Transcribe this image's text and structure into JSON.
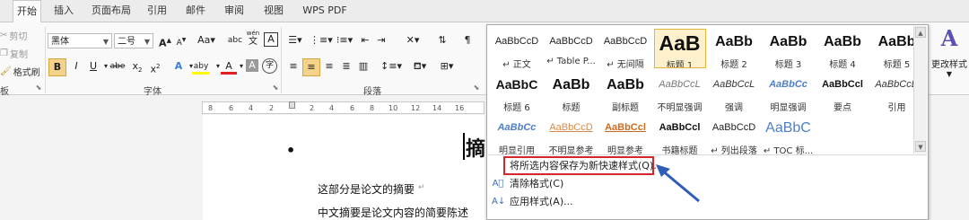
{
  "tabs": [
    "开始",
    "插入",
    "页面布局",
    "引用",
    "邮件",
    "审阅",
    "视图",
    "WPS PDF"
  ],
  "clipboard": {
    "cut": "剪切",
    "copy": "复制",
    "format_painter": "格式刷",
    "group_label": "板"
  },
  "font": {
    "name": "黑体",
    "size": "二号",
    "grow": "A",
    "shrink": "A",
    "case_label": "Aa",
    "clear_label": "abc",
    "pinyin_top": "wén",
    "pinyin_bottom": "文",
    "border_char": "A",
    "bold": "B",
    "italic": "I",
    "underline": "U",
    "strike": "abe",
    "subscript": "x",
    "superscript": "x",
    "effects": "A",
    "highlight": "aby",
    "color": "A",
    "shading_char": "A",
    "circle_char": "字",
    "group_label": "字体"
  },
  "paragraph": {
    "group_label": "段落"
  },
  "ruler": {
    "ticks": [
      "8",
      "6",
      "4",
      "2",
      "2",
      "4",
      "6",
      "8",
      "10",
      "12",
      "14",
      "16"
    ]
  },
  "document": {
    "title_char": "摘",
    "bullet": "•",
    "line1": "这部分是论文的摘要",
    "line2": "中文摘要是论文内容的简要陈述"
  },
  "styles": {
    "rows": [
      [
        {
          "preview": "AaBbCcD",
          "label": "↵ 正文"
        },
        {
          "preview": "AaBbCcD",
          "label": "↵ Table P..."
        },
        {
          "preview": "AaBbCcD",
          "label": "↵ 无间隔"
        },
        {
          "preview": "AaB",
          "label": "标题 1"
        },
        {
          "preview": "AaBb",
          "label": "标题 2"
        },
        {
          "preview": "AaBb",
          "label": "标题 3"
        },
        {
          "preview": "AaBb",
          "label": "标题 4"
        },
        {
          "preview": "AaBb",
          "label": "标题 5"
        }
      ],
      [
        {
          "preview": "AaBbC",
          "label": "标题 6"
        },
        {
          "preview": "AaBb",
          "label": "标题"
        },
        {
          "preview": "AaBb",
          "label": "副标题"
        },
        {
          "preview": "AaBbCcL",
          "label": "不明显强调"
        },
        {
          "preview": "AaBbCcL",
          "label": "强调"
        },
        {
          "preview": "AaBbCc",
          "label": "明显强调"
        },
        {
          "preview": "AaBbCcl",
          "label": "要点"
        },
        {
          "preview": "AaBbCcD",
          "label": "引用"
        }
      ],
      [
        {
          "preview": "AaBbCc",
          "label": "明显引用"
        },
        {
          "preview": "AaBbCcD",
          "label": "不明显参考"
        },
        {
          "preview": "AaBbCcl",
          "label": "明显参考"
        },
        {
          "preview": "AaBbCcl",
          "label": "书籍标题"
        },
        {
          "preview": "AaBbCcD",
          "label": "↵ 列出段落"
        },
        {
          "preview": "AaBbC",
          "label": "↵ TOC 标..."
        }
      ]
    ],
    "selected_label": "标题 1"
  },
  "menu": {
    "save_as_quick_style": "将所选内容保存为新快速样式(Q)...",
    "clear_formatting": "清除格式(C)",
    "apply_styles": "应用样式(A)..."
  },
  "change_styles": {
    "label": "更改样式",
    "glyph": "A"
  },
  "colors": {
    "accent": "#2f5db8",
    "highlight_box": "#d3272c",
    "selected_style": "#e8b33b",
    "arrow": "#2f5db8"
  }
}
